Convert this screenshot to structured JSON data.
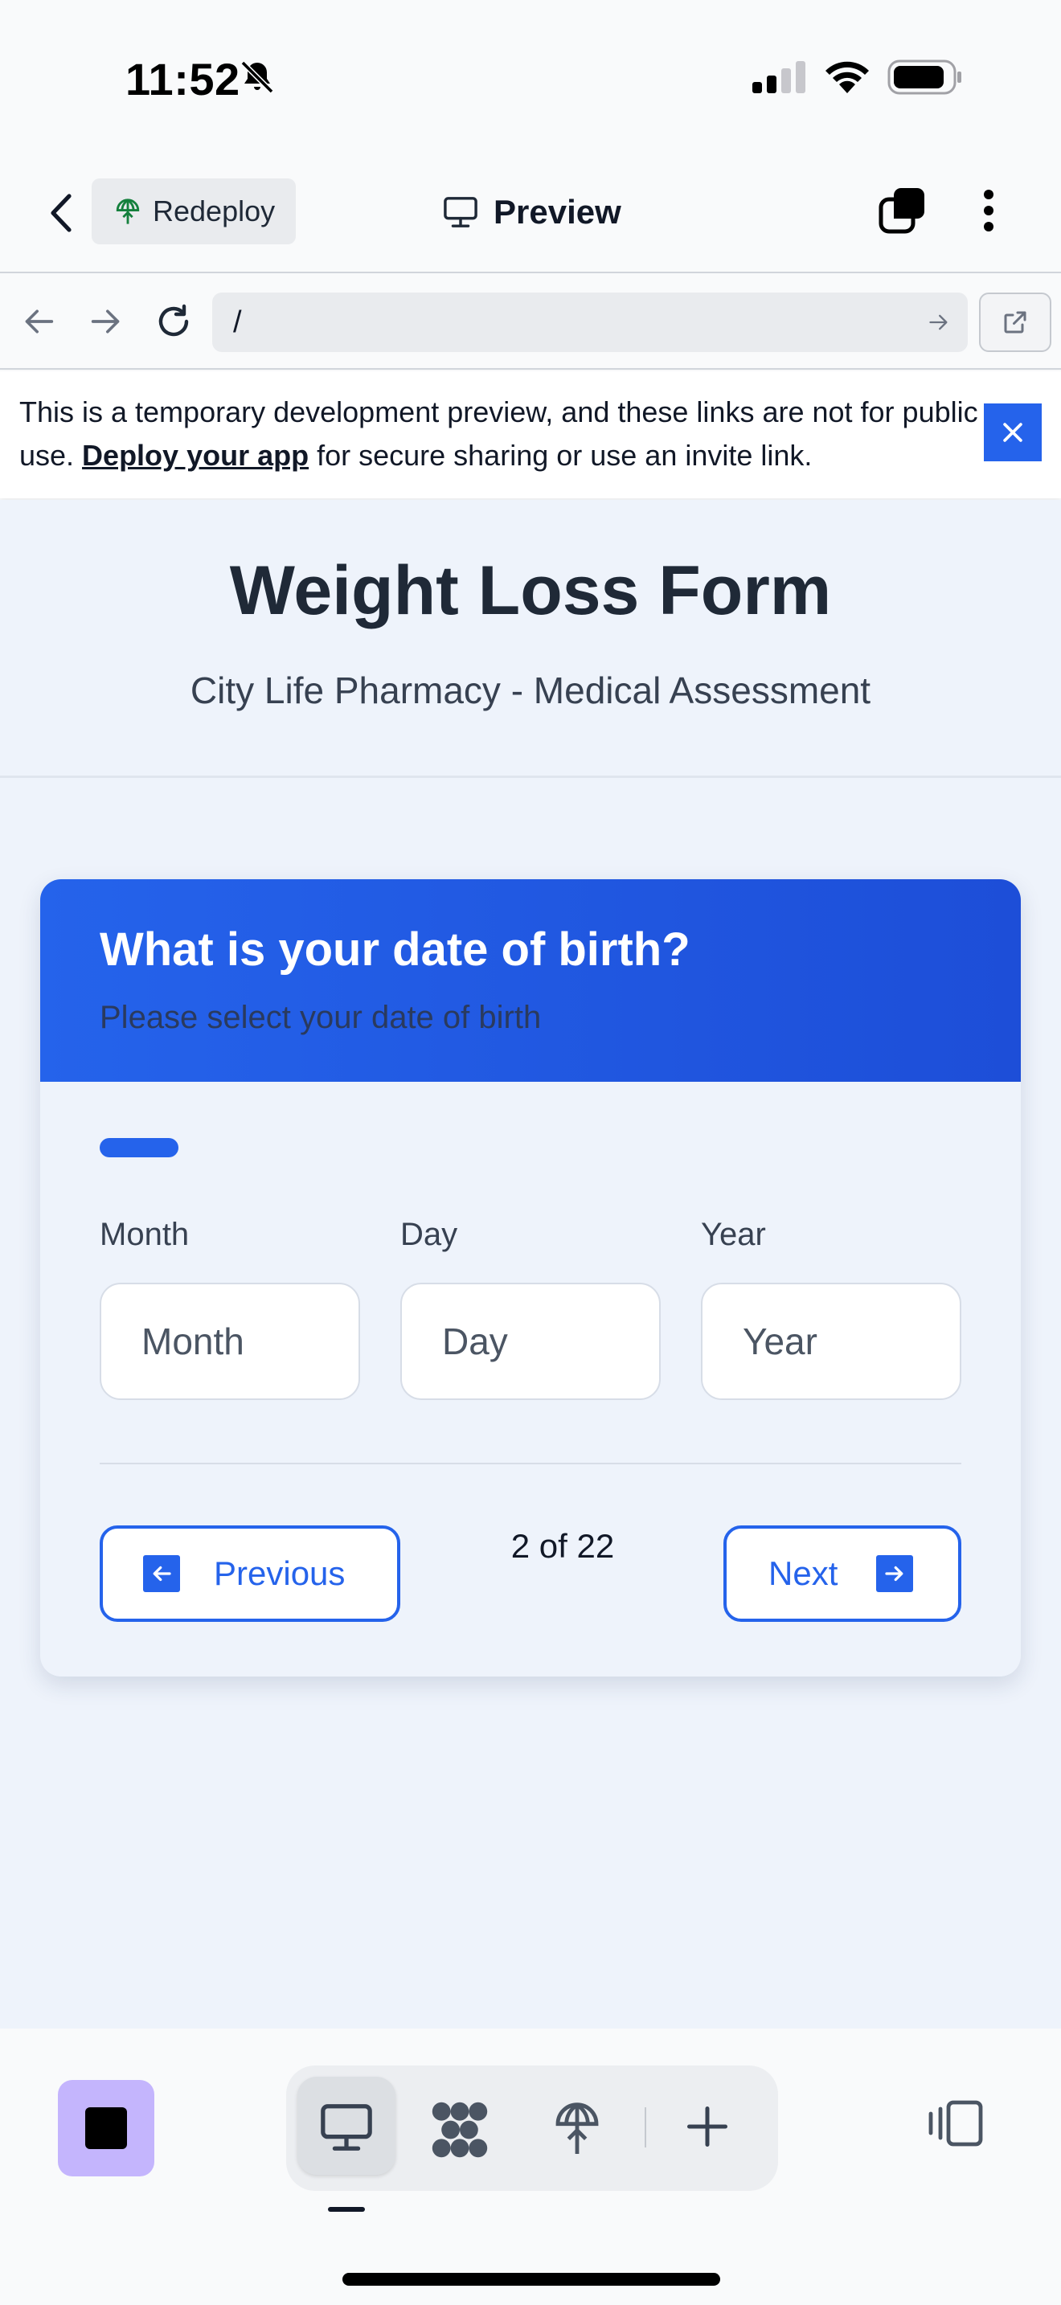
{
  "status_bar": {
    "time": "11:52"
  },
  "toolbar": {
    "redeploy_label": "Redeploy",
    "preview_label": "Preview"
  },
  "browser": {
    "url": "/"
  },
  "banner": {
    "text_before": "This is a temporary development preview, and these links are not for public use. ",
    "link_text": "Deploy your app",
    "text_after": " for secure sharing or use an invite link."
  },
  "form": {
    "title": "Weight Loss Form",
    "subtitle": "City Life Pharmacy - Medical Assessment"
  },
  "question": {
    "title": "What is your date of birth?",
    "hint": "Please select your date of birth",
    "fields": [
      {
        "label": "Month",
        "placeholder": "Month"
      },
      {
        "label": "Day",
        "placeholder": "Day"
      },
      {
        "label": "Year",
        "placeholder": "Year"
      }
    ]
  },
  "navigation": {
    "previous_label": "Previous",
    "next_label": "Next",
    "step_text": "2 of 22",
    "current_step": 2,
    "total_steps": 22
  },
  "colors": {
    "accent": "#2563eb",
    "page_background": "#eef3fb",
    "stop_button": "#c4b5fd"
  },
  "icons": {
    "status": [
      "bell-slash-icon",
      "cellular-signal-icon",
      "wifi-icon",
      "battery-icon"
    ],
    "toolbar": [
      "back-chevron-icon",
      "redeploy-icon",
      "monitor-icon",
      "tabs-icon",
      "more-vertical-icon"
    ],
    "browser": [
      "arrow-left-icon",
      "arrow-right-icon",
      "reload-icon",
      "go-arrow-icon",
      "external-link-icon"
    ],
    "bottom": [
      "stop-icon",
      "desktop-icon",
      "apps-icon",
      "deploy-icon",
      "plus-icon",
      "side-panel-icon"
    ]
  }
}
